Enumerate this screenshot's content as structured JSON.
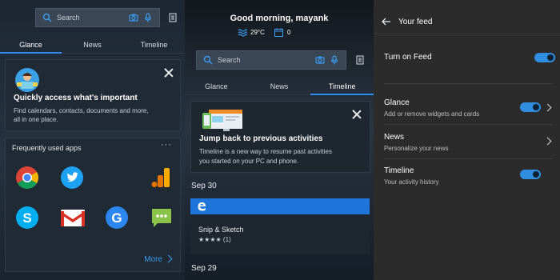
{
  "panel1": {
    "search_placeholder": "Search",
    "tabs": [
      "Glance",
      "News",
      "Timeline"
    ],
    "intro_title": "Quickly access what's important",
    "intro_body_1": "Find calendars, contacts, documents and more,",
    "intro_body_2": "all in one place.",
    "apps_title": "Frequently used apps",
    "more_label": "More",
    "apps": [
      "Chrome",
      "Twitter",
      "Google Analytics",
      "Skype",
      "Gmail",
      "Google",
      "Messaging"
    ]
  },
  "panel2": {
    "greeting": "Good morning, mayank",
    "temperature": "29°C",
    "calendar_count": "0",
    "search_placeholder": "Search",
    "tabs": [
      "Glance",
      "News",
      "Timeline"
    ],
    "intro_title": "Jump back to previous activities",
    "intro_body_1": "Timeline is a new way to resume past activities",
    "intro_body_2": "you started on your PC and phone.",
    "date1": "Sep 30",
    "item_title": "Snip & Sketch",
    "item_rating": "★★★★ (1)",
    "date2": "Sep 29",
    "accent": "#1e74d8"
  },
  "panel3": {
    "header": "Your feed",
    "turn_on_feed": "Turn on Feed",
    "glance_title": "Glance",
    "glance_sub": "Add or remove widgets and cards",
    "news_title": "News",
    "news_sub": "Personalize your news",
    "timeline_title": "Timeline",
    "timeline_sub": "Your activity history",
    "toggle_color": "#2f8ee0"
  }
}
